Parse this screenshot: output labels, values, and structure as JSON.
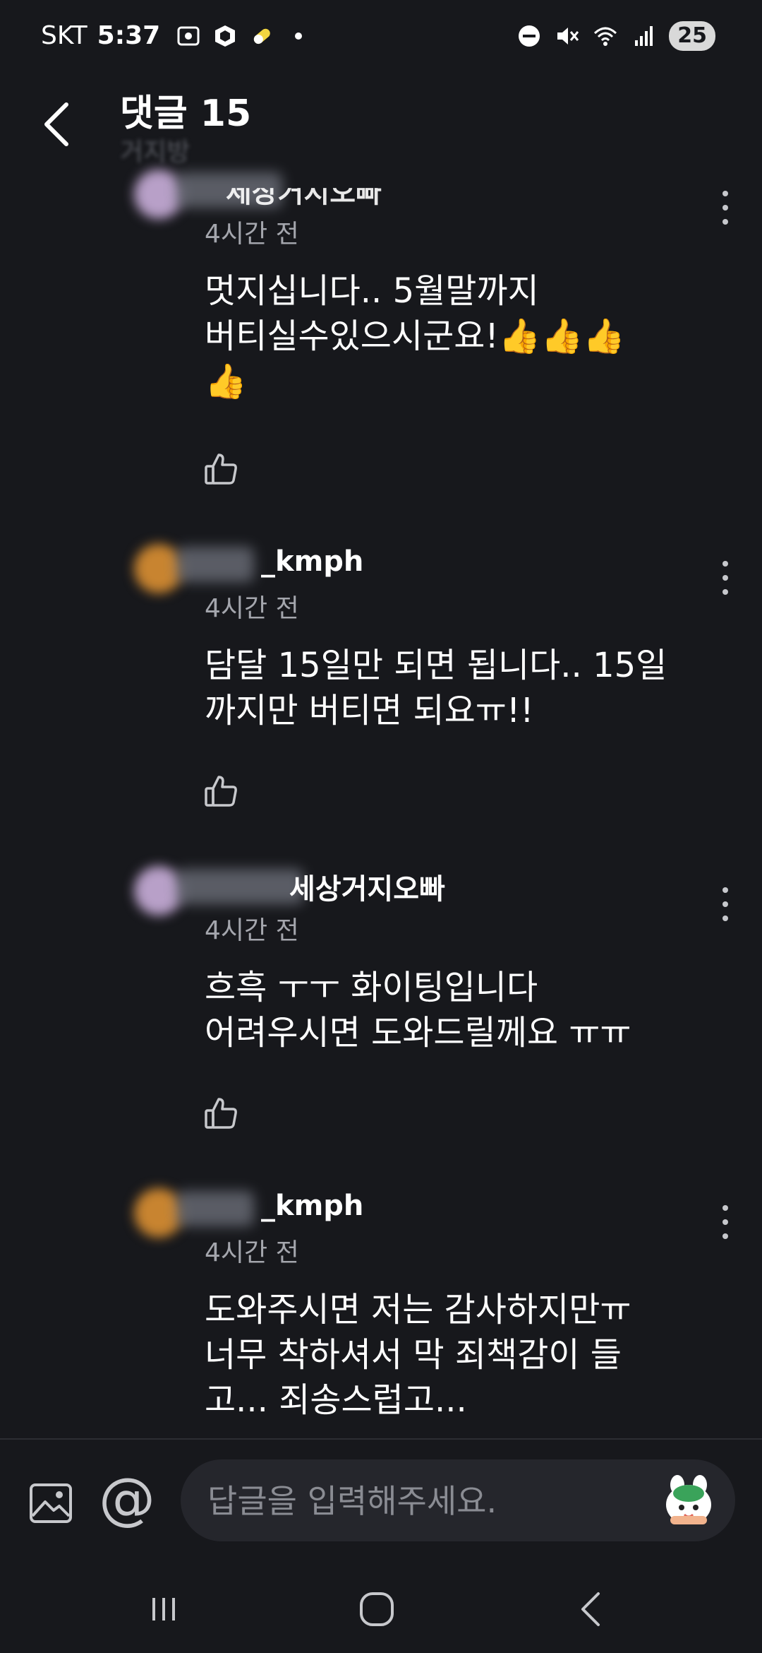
{
  "status_bar": {
    "carrier": "SKT",
    "time": "5:37",
    "battery": "25",
    "left_icons": [
      "screenshot-icon",
      "box-icon",
      "pill-icon",
      "dot-icon"
    ],
    "right_icons": [
      "dnd-icon",
      "mute-icon",
      "wifi-icon",
      "signal-icon"
    ]
  },
  "header": {
    "title": "댓글 15",
    "subtitle": "거지방"
  },
  "comments": [
    {
      "author": "세상거지오빠",
      "time": "4시간 전",
      "text_lines": [
        "멋지십니다.. 5월말까지",
        "버티실수있으시군요!👍👍👍",
        "👍"
      ],
      "avatar_color": "#b8a0c8"
    },
    {
      "author": "_kmph",
      "time": "4시간 전",
      "text_lines": [
        "담달 15일만 되면 됩니다.. 15일",
        "까지만 버티면 되요ㅠ!!"
      ],
      "avatar_color": "#c88430"
    },
    {
      "author": "세상거지오빠",
      "time": "4시간 전",
      "text_lines": [
        "흐흑 ㅜㅜ 화이팅입니다",
        "어려우시면 도와드릴께요 ㅠㅠ"
      ],
      "avatar_color": "#b8a0c8"
    },
    {
      "author": "_kmph",
      "time": "4시간 전",
      "text_lines": [
        "도와주시면 저는 감사하지만ㅠ",
        "너무 착하셔서 막 죄책감이 들",
        "고... 죄송스럽고..."
      ],
      "avatar_color": "#c88430"
    }
  ],
  "input": {
    "placeholder": "답글을 입력해주세요.",
    "at_symbol": "@"
  },
  "colors": {
    "background": "#17181c",
    "secondary_text": "#a4a6ad",
    "input_bg": "#25262c"
  }
}
